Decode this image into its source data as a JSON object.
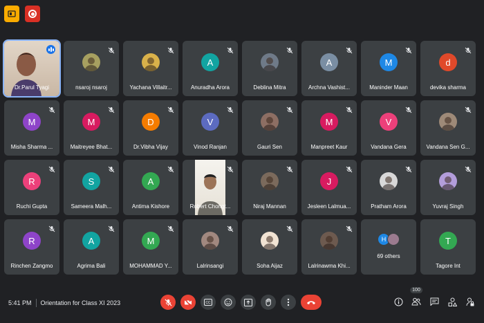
{
  "meeting": {
    "time": "5:41 PM",
    "title": "Orientation for Class XI 2023",
    "participant_count": "100"
  },
  "participants": [
    {
      "name": "Dr.Parul Tyagi",
      "type": "video",
      "color": "#b58f7a",
      "speaking": true
    },
    {
      "name": "nsaroj nsaroj",
      "type": "photo",
      "color": "#a7a060"
    },
    {
      "name": "Yachana Villaitr...",
      "type": "photo",
      "color": "#d9b14a"
    },
    {
      "name": "Anuradha Arora",
      "type": "initial",
      "initial": "A",
      "color": "#12a4a1"
    },
    {
      "name": "Deblina Mitra",
      "type": "photo",
      "color": "#6f7a88"
    },
    {
      "name": "Archna Vashist...",
      "type": "initial",
      "initial": "A",
      "color": "#7a8ea3"
    },
    {
      "name": "Maninder Maan",
      "type": "initial",
      "initial": "M",
      "color": "#1e88e5"
    },
    {
      "name": "devika sharma",
      "type": "initial",
      "initial": "d",
      "color": "#e0492a"
    },
    {
      "name": "Misha Sharma ...",
      "type": "initial",
      "initial": "M",
      "color": "#8e44c9"
    },
    {
      "name": "Maitreyee Bhat...",
      "type": "initial",
      "initial": "M",
      "color": "#d81b60"
    },
    {
      "name": "Dr.Vibha Vijay",
      "type": "initial",
      "initial": "D",
      "color": "#f57c00"
    },
    {
      "name": "Vinod Ranjan",
      "type": "initial",
      "initial": "V",
      "color": "#5c6bc0"
    },
    {
      "name": "Gauri Sen",
      "type": "photo",
      "color": "#8d6e63"
    },
    {
      "name": "Manpreet Kaur",
      "type": "initial",
      "initial": "M",
      "color": "#d81b60"
    },
    {
      "name": "Vandana Gera",
      "type": "initial",
      "initial": "V",
      "color": "#ec407a"
    },
    {
      "name": "Vandana Sen G...",
      "type": "photo",
      "color": "#9e8a78"
    },
    {
      "name": "Ruchi Gupta",
      "type": "initial",
      "initial": "R",
      "color": "#ec407a"
    },
    {
      "name": "Sameera Malh...",
      "type": "initial",
      "initial": "S",
      "color": "#12a4a1"
    },
    {
      "name": "Antima Kishore",
      "type": "initial",
      "initial": "A",
      "color": "#33a852"
    },
    {
      "name": "Robert Chongt...",
      "type": "video",
      "color": "#c9c3b4"
    },
    {
      "name": "Niraj Mannan",
      "type": "photo",
      "color": "#7b6a5c"
    },
    {
      "name": "Jesleen Lalmua...",
      "type": "initial",
      "initial": "J",
      "color": "#d81b60"
    },
    {
      "name": "Pratham Arora",
      "type": "photo",
      "color": "#d8d8d8"
    },
    {
      "name": "Yuvraj Singh",
      "type": "photo",
      "color": "#b39ddb"
    },
    {
      "name": "Rinchen Zangmo",
      "type": "initial",
      "initial": "R",
      "color": "#8e44c9"
    },
    {
      "name": "Agrima Bali",
      "type": "initial",
      "initial": "A",
      "color": "#12a4a1"
    },
    {
      "name": "MOHAMMAD Y...",
      "type": "initial",
      "initial": "M",
      "color": "#33a852"
    },
    {
      "name": "Lalrinsangi",
      "type": "photo",
      "color": "#a1887f"
    },
    {
      "name": "Soha Aijaz",
      "type": "photo",
      "color": "#f1e3d3"
    },
    {
      "name": "Lalrinawma Khi...",
      "type": "photo",
      "color": "#6d5a4f"
    },
    {
      "name": "69 others",
      "type": "others",
      "initial": "H",
      "color": "#1e88e5"
    },
    {
      "name": "Tagore Int",
      "type": "initial",
      "initial": "T",
      "color": "#33a852"
    }
  ],
  "controls": {
    "mic": "mic-off-icon",
    "camera": "camera-off-icon",
    "captions": "captions-icon",
    "reactions": "emoji-icon",
    "present": "present-icon",
    "raise_hand": "hand-icon",
    "more": "more-icon",
    "leave": "hangup-icon"
  },
  "colors": {
    "background": "#202124",
    "tile": "#3c4043",
    "danger": "#ea4335",
    "accent": "#8ab4f8"
  }
}
